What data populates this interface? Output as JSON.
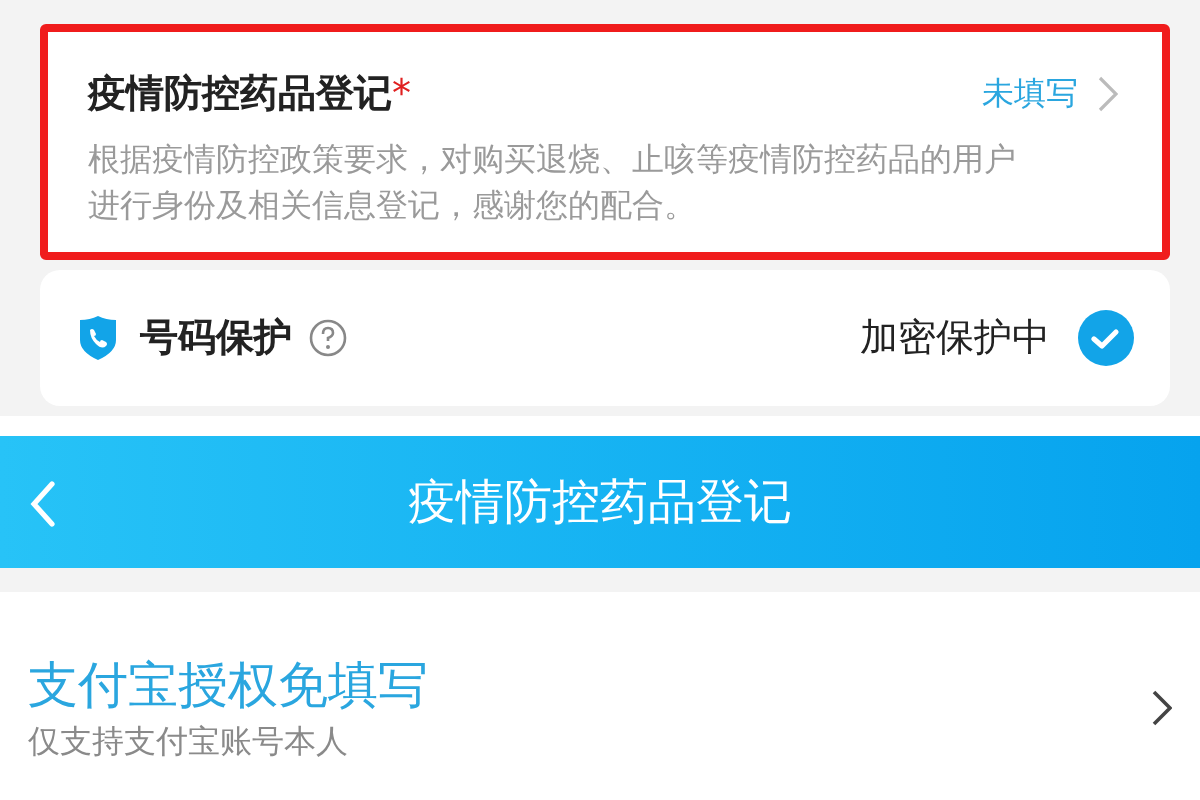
{
  "registration_card": {
    "title": "疫情防控药品登记",
    "required_mark": "*",
    "status": "未填写",
    "description": "根据疫情防控政策要求，对购买退烧、止咳等疫情防控药品的用户进行身份及相关信息登记，感谢您的配合。",
    "highlighted": true
  },
  "number_protection": {
    "label": "号码保护",
    "status": "加密保护中",
    "checked": true
  },
  "header": {
    "title": "疫情防控药品登记"
  },
  "alipay_option": {
    "title": "支付宝授权免填写",
    "subtitle": "仅支持支付宝账号本人"
  }
}
